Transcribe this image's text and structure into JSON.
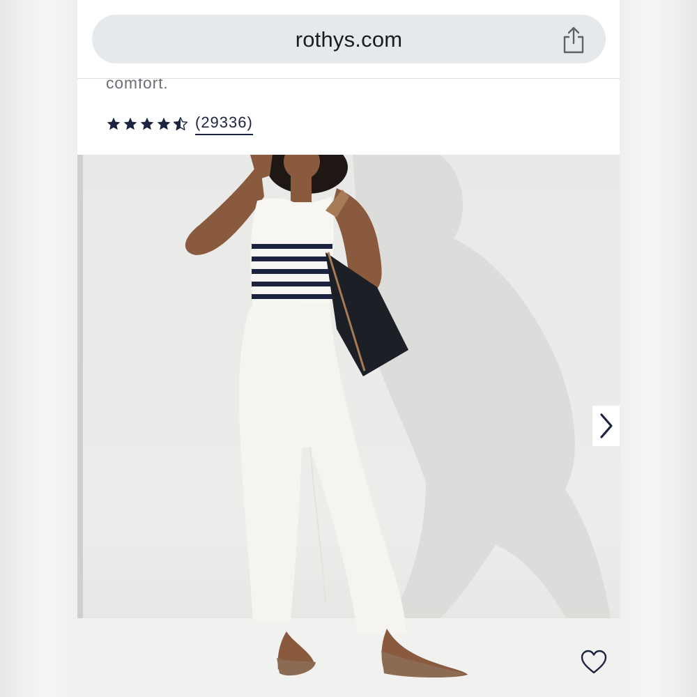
{
  "browser": {
    "url": "rothys.com",
    "share_icon": "share-icon"
  },
  "product": {
    "description_tail": "comfort.",
    "rating": {
      "stars_filled": 4.5,
      "stars_total": 5,
      "review_count": "(29336)"
    }
  },
  "gallery": {
    "image_alt": "Model in striped tank, white jeans, black tote and brown flats",
    "next_icon": "chevron-right-icon",
    "favorite_icon": "heart-icon"
  },
  "colors": {
    "navy": "#1b2340",
    "url_bar": "#e6e9ec"
  }
}
